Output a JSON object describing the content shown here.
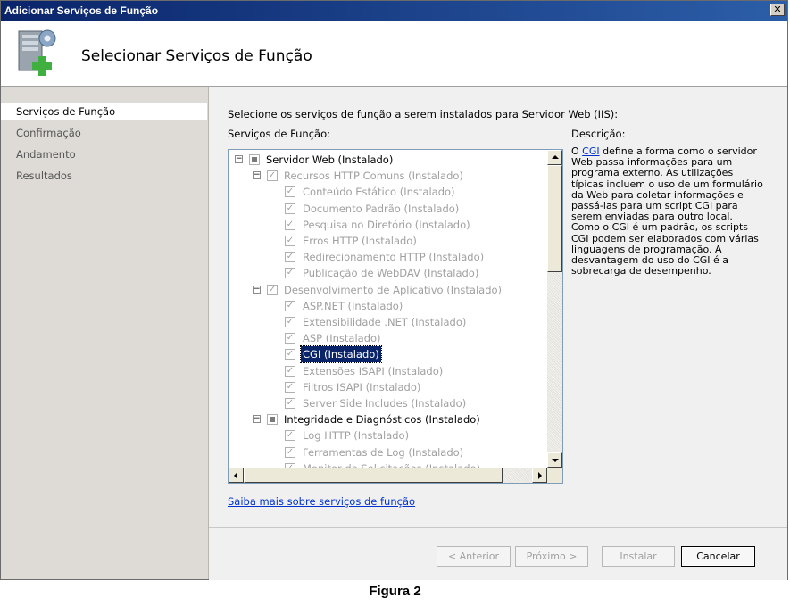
{
  "window": {
    "title": "Adicionar Serviços de Função"
  },
  "header": {
    "title": "Selecionar Serviços de Função",
    "icon": "server-add-icon"
  },
  "sidebar": {
    "items": [
      {
        "label": "Serviços de Função",
        "active": true
      },
      {
        "label": "Confirmação",
        "active": false
      },
      {
        "label": "Andamento",
        "active": false
      },
      {
        "label": "Resultados",
        "active": false
      }
    ]
  },
  "main": {
    "instruction": "Selecione os serviços de função a serem instalados para Servidor Web (IIS):",
    "services_label": "Serviços de Função:",
    "description_label": "Descrição:",
    "tree": [
      {
        "label": "Servidor Web  (Instalado)",
        "level": 0,
        "expander": "−",
        "check": "partial",
        "dark": true
      },
      {
        "label": "Recursos HTTP Comuns  (Instalado)",
        "level": 1,
        "expander": "−",
        "check": "checked"
      },
      {
        "label": "Conteúdo Estático  (Instalado)",
        "level": 2,
        "check": "checked"
      },
      {
        "label": "Documento Padrão  (Instalado)",
        "level": 2,
        "check": "checked"
      },
      {
        "label": "Pesquisa no Diretório  (Instalado)",
        "level": 2,
        "check": "checked"
      },
      {
        "label": "Erros HTTP  (Instalado)",
        "level": 2,
        "check": "checked"
      },
      {
        "label": "Redirecionamento HTTP  (Instalado)",
        "level": 2,
        "check": "checked"
      },
      {
        "label": "Publicação de WebDAV  (Instalado)",
        "level": 2,
        "check": "checked"
      },
      {
        "label": "Desenvolvimento de Aplicativo  (Instalado)",
        "level": 1,
        "expander": "−",
        "check": "checked"
      },
      {
        "label": "ASP.NET  (Instalado)",
        "level": 2,
        "check": "checked"
      },
      {
        "label": "Extensibilidade .NET  (Instalado)",
        "level": 2,
        "check": "checked"
      },
      {
        "label": "ASP  (Instalado)",
        "level": 2,
        "check": "checked"
      },
      {
        "label": "CGI  (Instalado)",
        "level": 2,
        "check": "checked",
        "selected": true
      },
      {
        "label": "Extensões ISAPI  (Instalado)",
        "level": 2,
        "check": "checked"
      },
      {
        "label": "Filtros ISAPI  (Instalado)",
        "level": 2,
        "check": "checked"
      },
      {
        "label": "Server Side Includes  (Instalado)",
        "level": 2,
        "check": "checked"
      },
      {
        "label": "Integridade e Diagnósticos  (Instalado)",
        "level": 1,
        "expander": "−",
        "check": "partial",
        "dark": true
      },
      {
        "label": "Log HTTP  (Instalado)",
        "level": 2,
        "check": "checked"
      },
      {
        "label": "Ferramentas de Log  (Instalado)",
        "level": 2,
        "check": "checked"
      },
      {
        "label": "Monitor de Solicitações  (Instalado)",
        "level": 2,
        "check": "checked"
      }
    ],
    "description": {
      "pre": "O ",
      "link": "CGI",
      "post": " define a forma como o servidor Web passa informações para um programa externo. As utilizações típicas incluem o uso de um formulário da Web para coletar informações e passá-las para um script CGI para serem enviadas para outro local. Como o CGI é um padrão, os scripts CGI podem ser elaborados com várias linguagens de programação. A desvantagem do uso do CGI é a sobrecarga de desempenho."
    },
    "more_link": "Saiba mais sobre serviços de função"
  },
  "footer": {
    "prev_label": "< Anterior",
    "next_label": "Próximo >",
    "install_label": "Instalar",
    "cancel_label": "Cancelar"
  },
  "caption": "Figura 2"
}
